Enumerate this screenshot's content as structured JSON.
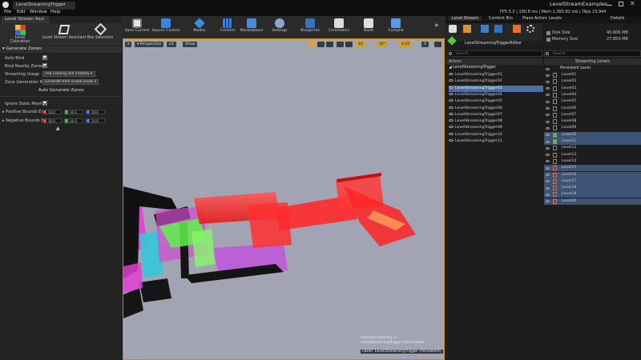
{
  "title_bar": {
    "tab": "LevelStreamingTrigger",
    "project": "LevelStreamExamples",
    "stats": "FPS 5.2 | 190.8 ms | Mem 1,365.82 mb | Objs 23,944"
  },
  "menu": [
    "File",
    "Edit",
    "Window",
    "Help"
  ],
  "left_panel": {
    "tab": "Level Stream Assi",
    "tools": [
      "Level Coloration",
      "Level Stream Assistant",
      "Box Selection"
    ],
    "section": "Generate Zones",
    "auto_bind": "Auto Bind",
    "bind_nearby": "Bind Nearby Zones",
    "streaming_usage_label": "Streaming Usage",
    "streaming_usage_value": "SVB Loading and Visibility",
    "zone_gen_label": "Zone Generation Me",
    "zone_gen_value": "Generate from visible levels",
    "generate_button": "Auto Generate Zones",
    "ignore_static": "Ignore Static Mesh E",
    "positive_bounds": "Positive Bounds Ext",
    "negative_bounds": "Negative Bounds Ex",
    "axis_x": "X",
    "axis_y": "Y",
    "axis_z": "Z",
    "bound_value": "10.0"
  },
  "toolbar": [
    "Save Current",
    "Source Control",
    "Modes",
    "Content",
    "Marketplace",
    "Settings",
    "Blueprints",
    "Cinematics",
    "Build",
    "Compile"
  ],
  "viewport": {
    "perspective": "Perspective",
    "lit": "Lit",
    "show": "Show",
    "grid": "10",
    "angle": "10°",
    "scale": "0.25",
    "cam": "4",
    "selected_line1": "Selected Actor(s) in:",
    "selected_line2": "LevelStreamingTrigger (Persistent)",
    "level_label": "Level: LevelStreamingTrigger (Persistent)"
  },
  "right_panel": {
    "tabs": [
      "Level Stream",
      "Content Bro",
      "Place Actors",
      "Levels",
      "Details"
    ],
    "editor_name": "LevelStreamingTriggerEditor",
    "search_placeholder": "Search",
    "disk_size_label": "Disk Size",
    "disk_size_value": "40.606 MB",
    "memory_size_label": "Memory Size",
    "memory_size_value": "27.853 MB",
    "actors_header": "Actors",
    "actors_root": "LevelStreamingTrigger",
    "actors": [
      "LevelStreamingTrigger01",
      "LevelStreamingTrigger02",
      "LevelStreamingTrigger03",
      "LevelStreamingTrigger04",
      "LevelStreamingTrigger05",
      "LevelStreamingTrigger06",
      "LevelStreamingTrigger07",
      "LevelStreamingTrigger08",
      "LevelStreamingTrigger09",
      "LevelStreamingTrigger10",
      "LevelStreamingTrigger11"
    ],
    "selected_actor_index": 2,
    "levels_header": "Streaming Levels",
    "persistent": "Persistent Level",
    "levels": [
      {
        "name": "Level01",
        "color": "#1a1a1a",
        "sel": false
      },
      {
        "name": "Level02",
        "color": "#1a1a1a",
        "sel": false
      },
      {
        "name": "Level03",
        "color": "#1a1a1a",
        "sel": false
      },
      {
        "name": "Level04",
        "color": "#1a1a1a",
        "sel": false
      },
      {
        "name": "Level05",
        "color": "#1a1a1a",
        "sel": false
      },
      {
        "name": "Level06",
        "color": "#1a1a1a",
        "sel": false
      },
      {
        "name": "Level07",
        "color": "#1a1a1a",
        "sel": false
      },
      {
        "name": "Level08",
        "color": "#1a1a1a",
        "sel": false
      },
      {
        "name": "Level09",
        "color": "#1a1a1a",
        "sel": false
      },
      {
        "name": "Level10",
        "color": "#22e02a",
        "sel": true
      },
      {
        "name": "Level11",
        "color": "#22e02a",
        "sel": true
      },
      {
        "name": "Level12",
        "color": "#1a1a1a",
        "sel": false
      },
      {
        "name": "Level13",
        "color": "#1a1a1a",
        "sel": false
      },
      {
        "name": "Level14",
        "color": "#1a1a1a",
        "sel": false
      },
      {
        "name": "Level15",
        "color": "#e01818",
        "sel": true
      },
      {
        "name": "Level16",
        "color": "#e01818",
        "sel": true
      },
      {
        "name": "Level17",
        "color": "#e01818",
        "sel": true
      },
      {
        "name": "Level18",
        "color": "#e01818",
        "sel": true
      },
      {
        "name": "Level19",
        "color": "#e01818",
        "sel": true
      },
      {
        "name": "Level20",
        "color": "#e01818",
        "sel": true
      }
    ]
  }
}
